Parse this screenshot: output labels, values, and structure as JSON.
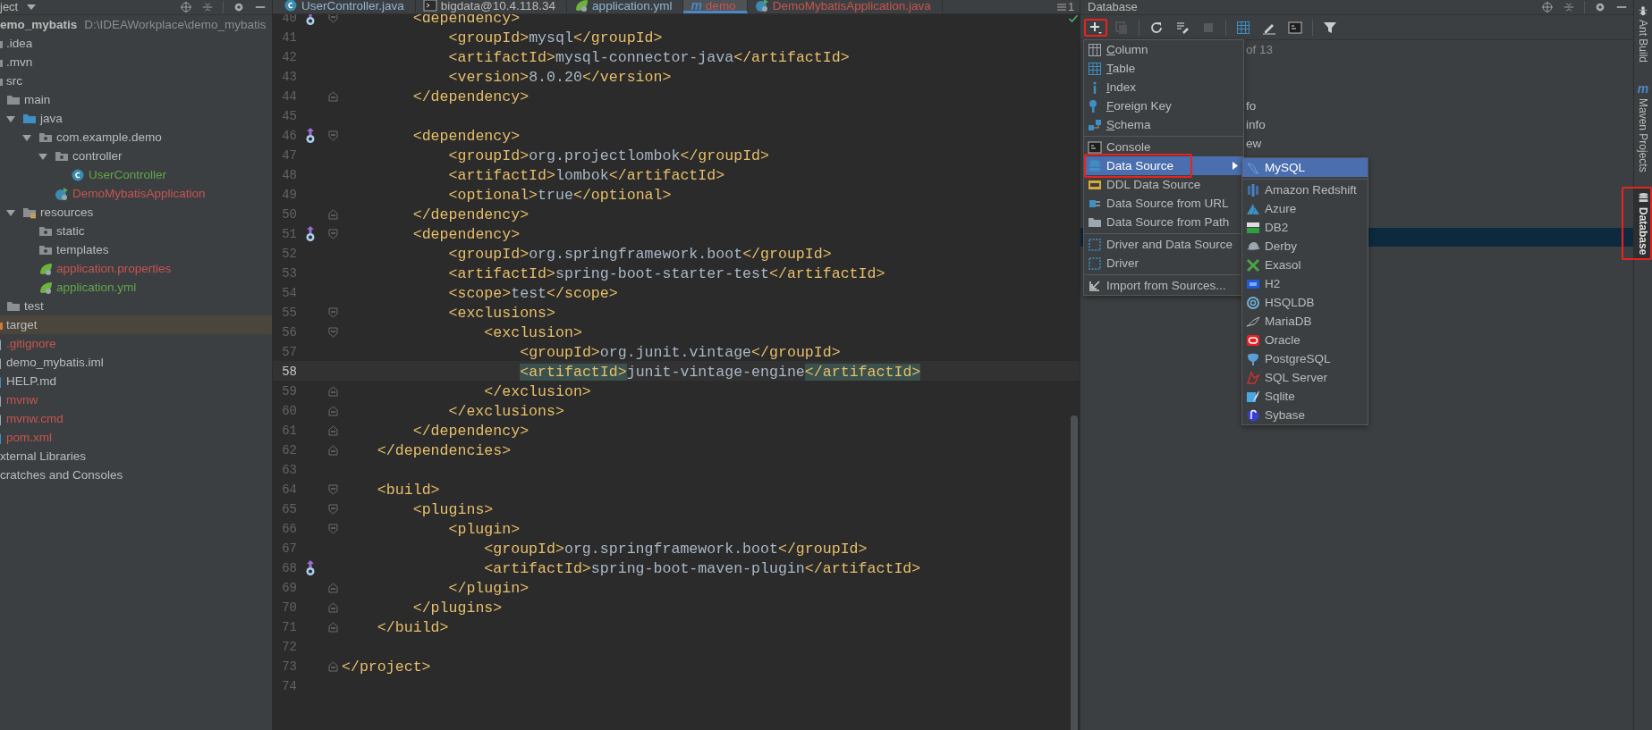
{
  "project": {
    "title": "ject",
    "tree": [
      {
        "label": "emo_mybatis",
        "path": "D:\\IDEAWorkplace\\demo_mybatis",
        "kind": "module",
        "color": "#bbbbbb",
        "selected": false,
        "children": [
          {
            "label": ".idea",
            "kind": "folder",
            "color": "#bbbbbb",
            "selected": false
          },
          {
            "label": ".mvn",
            "kind": "folder",
            "color": "#bbbbbb",
            "selected": false
          },
          {
            "label": "src",
            "kind": "folder",
            "color": "#bbbbbb",
            "selected": false,
            "children": [
              {
                "label": "main",
                "kind": "folder",
                "color": "#bbbbbb",
                "selected": false,
                "children": [
                  {
                    "label": "java",
                    "kind": "source",
                    "color": "#bbbbbb",
                    "selected": false,
                    "expanded": true,
                    "children": [
                      {
                        "label": "com.example.demo",
                        "kind": "package",
                        "color": "#bbbbbb",
                        "selected": false,
                        "expanded": true,
                        "children": [
                          {
                            "label": "controller",
                            "kind": "package",
                            "color": "#bbbbbb",
                            "selected": false,
                            "expanded": true,
                            "children": [
                              {
                                "label": "UserController",
                                "kind": "class",
                                "color": "#62a64a",
                                "selected": false
                              }
                            ]
                          },
                          {
                            "label": "DemoMybatisApplication",
                            "kind": "app",
                            "color": "#c75450",
                            "selected": false
                          }
                        ]
                      }
                    ]
                  },
                  {
                    "label": "resources",
                    "kind": "resources",
                    "color": "#bbbbbb",
                    "selected": false,
                    "expanded": true,
                    "children": [
                      {
                        "label": "static",
                        "kind": "package",
                        "color": "#bbbbbb",
                        "selected": false
                      },
                      {
                        "label": "templates",
                        "kind": "package",
                        "color": "#bbbbbb",
                        "selected": false
                      },
                      {
                        "label": "application.properties",
                        "kind": "spring",
                        "color": "#c75450",
                        "selected": false
                      },
                      {
                        "label": "application.yml",
                        "kind": "spring",
                        "color": "#62a64a",
                        "selected": false
                      }
                    ]
                  }
                ]
              },
              {
                "label": "test",
                "kind": "folder",
                "color": "#bbbbbb",
                "selected": false
              }
            ]
          },
          {
            "label": "target",
            "kind": "excluded",
            "color": "#bbbbbb",
            "selected": true
          },
          {
            "label": ".gitignore",
            "kind": "file",
            "color": "#c75450",
            "selected": false
          },
          {
            "label": "demo_mybatis.iml",
            "kind": "file",
            "color": "#bbbbbb",
            "selected": false
          },
          {
            "label": "HELP.md",
            "kind": "markdown",
            "color": "#bbbbbb",
            "selected": false
          },
          {
            "label": "mvnw",
            "kind": "file",
            "color": "#c75450",
            "selected": false
          },
          {
            "label": "mvnw.cmd",
            "kind": "file",
            "color": "#c75450",
            "selected": false
          },
          {
            "label": "pom.xml",
            "kind": "markdown",
            "color": "#c75450",
            "selected": false
          }
        ]
      },
      {
        "label": "xternal Libraries",
        "kind": "library",
        "color": "#bbbbbb",
        "selected": false
      },
      {
        "label": "cratches and Consoles",
        "kind": "scratch",
        "color": "#bbbbbb",
        "selected": false
      }
    ]
  },
  "editor": {
    "tabs": [
      {
        "label": "UserController.java",
        "kind": "class",
        "color": "#8fb4d4",
        "selected": false
      },
      {
        "label": "bigdata@10.4.118.34",
        "kind": "console",
        "color": "#bbbbbb",
        "selected": false
      },
      {
        "label": "application.yml",
        "kind": "spring",
        "color": "#8fb4d4",
        "selected": false
      },
      {
        "label": "demo",
        "kind": "maven",
        "icon_text": "m",
        "color": "#c75450",
        "selected": true
      },
      {
        "label": "DemoMybatisApplication.java",
        "kind": "app",
        "color": "#c75450",
        "selected": false
      }
    ],
    "tab_count": "1",
    "lines": [
      {
        "number": "40",
        "code": "        <dependency>",
        "fold_start": true,
        "gutter_mark": true
      },
      {
        "number": "41",
        "code": "            <groupId>mysql</groupId>"
      },
      {
        "number": "42",
        "code": "            <artifactId>mysql-connector-java</artifactId>"
      },
      {
        "number": "43",
        "code": "            <version>8.0.20</version>"
      },
      {
        "number": "44",
        "code": "        </dependency>",
        "fold_end": true
      },
      {
        "number": "45"
      },
      {
        "number": "46",
        "code": "        <dependency>",
        "fold_start": true,
        "gutter_mark": true
      },
      {
        "number": "47",
        "code": "            <groupId>org.projectlombok</groupId>"
      },
      {
        "number": "48",
        "code": "            <artifactId>lombok</artifactId>"
      },
      {
        "number": "49",
        "code": "            <optional>true</optional>"
      },
      {
        "number": "50",
        "code": "        </dependency>",
        "fold_end": true
      },
      {
        "number": "51",
        "code": "        <dependency>",
        "fold_start": true,
        "gutter_mark": true
      },
      {
        "number": "52",
        "code": "            <groupId>org.springframework.boot</groupId>"
      },
      {
        "number": "53",
        "code": "            <artifactId>spring-boot-starter-test</artifactId>"
      },
      {
        "number": "54",
        "code": "            <scope>test</scope>"
      },
      {
        "number": "55",
        "code": "            <exclusions>",
        "fold_start": true
      },
      {
        "number": "56",
        "code": "                <exclusion>",
        "fold_start": true
      },
      {
        "number": "57",
        "code": "                    <groupId>org.junit.vintage</groupId>"
      },
      {
        "number": "58",
        "code": "                    <artifactId>junit-vintage-engine</artifactId>",
        "current": true,
        "matched": true
      },
      {
        "number": "59",
        "code": "                </exclusion>",
        "fold_end": true
      },
      {
        "number": "60",
        "code": "            </exclusions>",
        "fold_end": true
      },
      {
        "number": "61",
        "code": "        </dependency>",
        "fold_end": true
      },
      {
        "number": "62",
        "code": "    </dependencies>",
        "fold_end": true
      },
      {
        "number": "63"
      },
      {
        "number": "64",
        "code": "    <build>",
        "fold_start": true
      },
      {
        "number": "65",
        "code": "        <plugins>",
        "fold_start": true
      },
      {
        "number": "66",
        "code": "            <plugin>",
        "fold_start": true
      },
      {
        "number": "67",
        "code": "                <groupId>org.springframework.boot</groupId>"
      },
      {
        "number": "68",
        "code": "                <artifactId>spring-boot-maven-plugin</artifactId>",
        "gutter_mark": true
      },
      {
        "number": "69",
        "code": "            </plugin>",
        "fold_end": true
      },
      {
        "number": "70",
        "code": "        </plugins>",
        "fold_end": true
      },
      {
        "number": "71",
        "code": "    </build>",
        "fold_end": true
      },
      {
        "number": "72"
      },
      {
        "number": "73",
        "code": "</project>",
        "fold_end": true
      },
      {
        "number": "74"
      }
    ]
  },
  "database": {
    "title": "Database",
    "toolbar": [
      {
        "kind": "add",
        "disabled": false,
        "annotated": true
      },
      {
        "kind": "copy",
        "disabled": true,
        "annotated": false
      },
      {
        "kind": "separator"
      },
      {
        "kind": "refresh",
        "disabled": false,
        "annotated": false
      },
      {
        "kind": "wrench",
        "disabled": false,
        "annotated": false
      },
      {
        "kind": "stop",
        "disabled": true,
        "annotated": false
      },
      {
        "kind": "separator"
      },
      {
        "kind": "table",
        "disabled": false,
        "annotated": false
      },
      {
        "kind": "pencil",
        "disabled": false,
        "annotated": false
      },
      {
        "kind": "console",
        "disabled": false,
        "annotated": false
      },
      {
        "kind": "separator"
      },
      {
        "kind": "filter",
        "disabled": false,
        "annotated": false
      }
    ],
    "tree_rows": [
      {
        "text": "of 13",
        "kind": "count",
        "selected": false
      },
      {
        "kind": "blank",
        "selected": false
      },
      {
        "kind": "blank",
        "selected": false
      },
      {
        "text": "fo",
        "kind": "node",
        "selected": false
      },
      {
        "text": "info",
        "kind": "node",
        "selected": false
      },
      {
        "text": "ew",
        "kind": "node",
        "selected": false
      },
      {
        "kind": "blank",
        "selected": false
      },
      {
        "kind": "blank",
        "selected": false
      },
      {
        "kind": "blank",
        "selected": false
      },
      {
        "kind": "blank",
        "selected": false
      },
      {
        "kind": "blank",
        "selected": true
      }
    ],
    "add_menu": [
      {
        "kind": "column",
        "label": "Column",
        "underline_first": true,
        "selected": false,
        "submenu": false,
        "annotated": false
      },
      {
        "kind": "table",
        "label": "Table",
        "underline_first": true,
        "selected": false,
        "submenu": false,
        "annotated": false
      },
      {
        "kind": "index",
        "label": "Index",
        "underline_first": true,
        "selected": false,
        "submenu": false,
        "annotated": false
      },
      {
        "kind": "key",
        "label": "Foreign Key",
        "underline_first": true,
        "selected": false,
        "submenu": false,
        "annotated": false
      },
      {
        "kind": "schema",
        "label": "Schema",
        "underline_first": true,
        "selected": false,
        "submenu": false,
        "annotated": false
      },
      {
        "kind": "separator"
      },
      {
        "kind": "console",
        "label": "Console",
        "underline_first": false,
        "selected": false,
        "submenu": false,
        "annotated": false
      },
      {
        "kind": "datasource",
        "label": "Data Source",
        "underline_first": false,
        "selected": true,
        "submenu": true,
        "annotated": true
      },
      {
        "kind": "ddl",
        "label": "DDL Data Source",
        "underline_first": false,
        "selected": false,
        "submenu": false,
        "annotated": false
      },
      {
        "kind": "url",
        "label": "Data Source from URL",
        "underline_first": false,
        "selected": false,
        "submenu": false,
        "annotated": false
      },
      {
        "kind": "path",
        "label": "Data Source from Path",
        "underline_first": false,
        "selected": false,
        "submenu": false,
        "annotated": false
      },
      {
        "kind": "separator"
      },
      {
        "kind": "driver",
        "label": "Driver and Data Source",
        "underline_first": false,
        "selected": false,
        "submenu": false,
        "annotated": false
      },
      {
        "kind": "driver",
        "label": "Driver",
        "underline_first": false,
        "selected": false,
        "submenu": false,
        "annotated": false
      },
      {
        "kind": "separator"
      },
      {
        "kind": "import",
        "label": "Import from Sources...",
        "underline_first": false,
        "selected": false,
        "submenu": false,
        "annotated": false
      }
    ],
    "source_menu": [
      {
        "kind": "mysql",
        "label": "MySQL",
        "selected": true
      },
      {
        "kind": "separator"
      },
      {
        "kind": "redshift",
        "label": "Amazon Redshift",
        "selected": false
      },
      {
        "kind": "azure",
        "label": "Azure",
        "selected": false
      },
      {
        "kind": "db2",
        "label": "DB2",
        "selected": false
      },
      {
        "kind": "derby",
        "label": "Derby",
        "selected": false
      },
      {
        "kind": "exasol",
        "label": "Exasol",
        "selected": false
      },
      {
        "kind": "h2",
        "label": "H2",
        "selected": false
      },
      {
        "kind": "hsqldb",
        "label": "HSQLDB",
        "selected": false
      },
      {
        "kind": "mariadb",
        "label": "MariaDB",
        "selected": false
      },
      {
        "kind": "oracle",
        "label": "Oracle",
        "selected": false
      },
      {
        "kind": "postgres",
        "label": "PostgreSQL",
        "selected": false
      },
      {
        "kind": "sqlserver",
        "label": "SQL Server",
        "selected": false
      },
      {
        "kind": "sqlite",
        "label": "Sqlite",
        "selected": false
      },
      {
        "kind": "sybase",
        "label": "Sybase",
        "selected": false
      }
    ]
  },
  "side_tabs": [
    {
      "label": "Ant Build",
      "kind": "ant",
      "selected": false,
      "annotated": false
    },
    {
      "label": "Maven Projects",
      "kind": "maven",
      "icon_text": "m",
      "selected": false,
      "annotated": false
    },
    {
      "label": "Database",
      "kind": "database",
      "selected": true,
      "annotated": true
    }
  ]
}
